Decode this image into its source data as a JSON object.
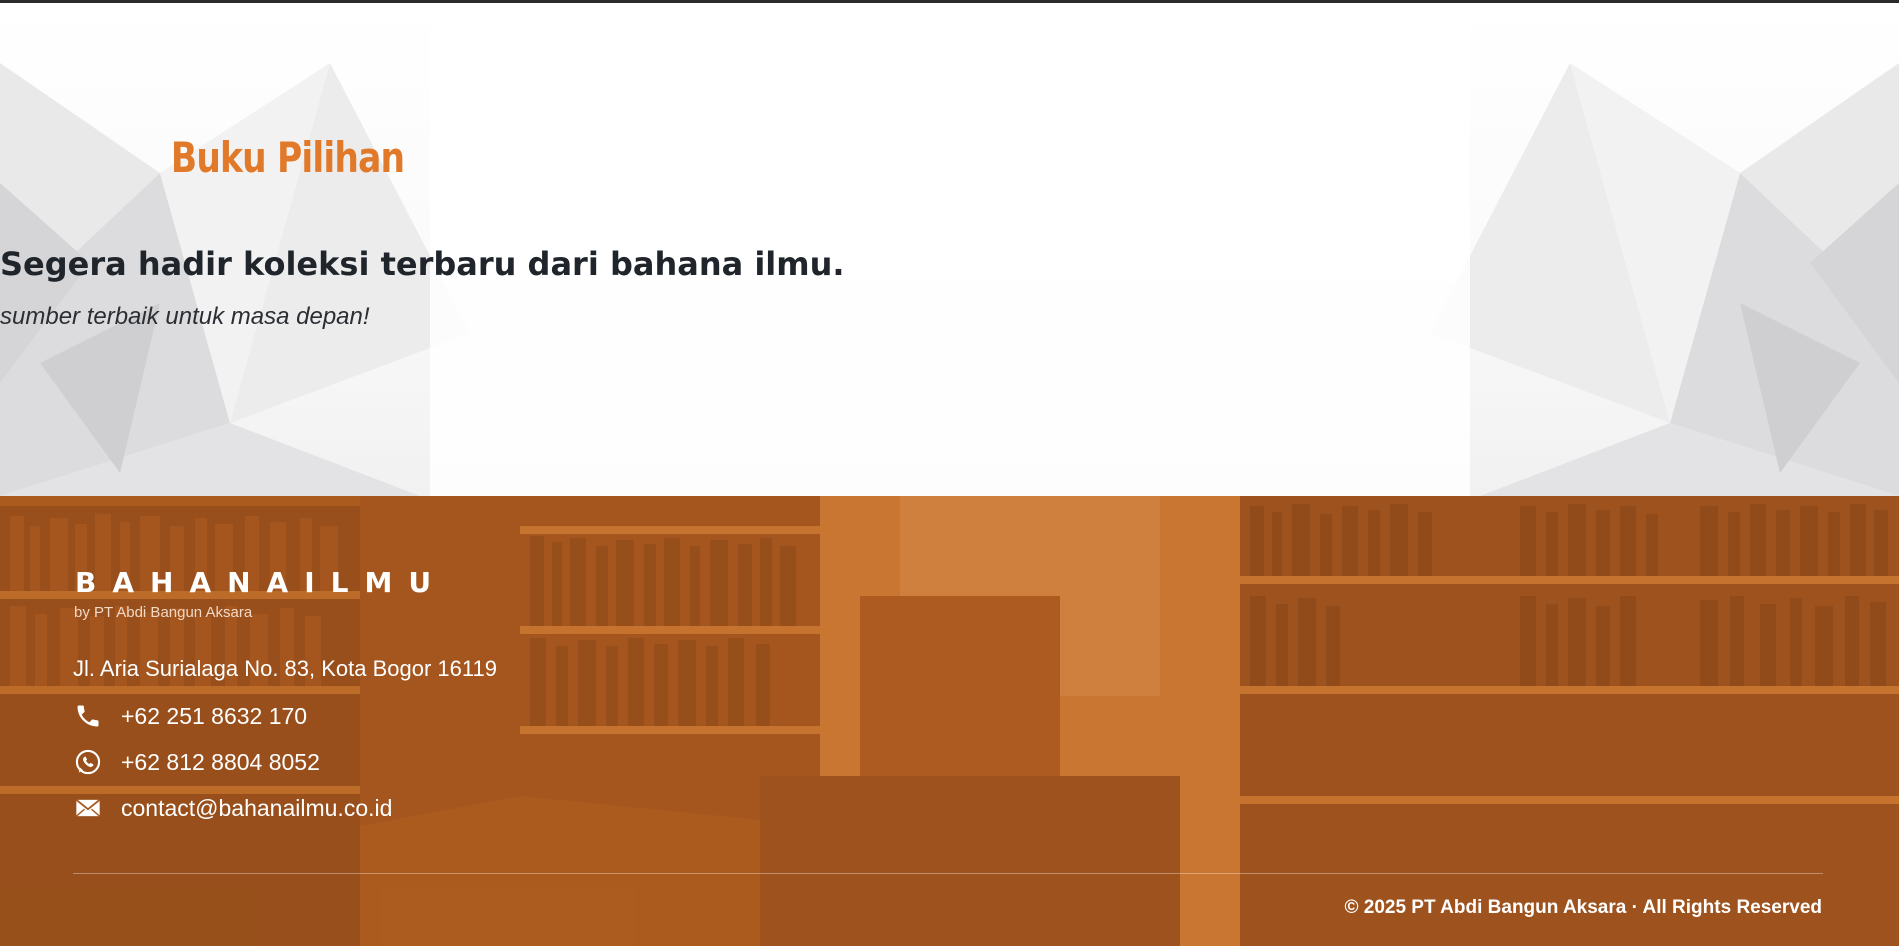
{
  "hero": {
    "title": "Buku Pilihan",
    "heading": "Segera hadir koleksi terbaru dari bahana ilmu.",
    "subheading": "sumber terbaik untuk masa depan!"
  },
  "footer": {
    "brand": "BAHANAILMU",
    "brand_by": "by PT Abdi Bangun Aksara",
    "address": "Jl. Aria Surialaga No. 83, Kota Bogor 16119",
    "contacts": [
      {
        "icon": "phone-icon",
        "text": "+62 251 8632 170"
      },
      {
        "icon": "whatsapp-icon",
        "text": "+62 812 8804 8052"
      },
      {
        "icon": "mail-icon",
        "text": "contact@bahanailmu.co.id"
      }
    ],
    "copyright": "© 2025 PT Abdi Bangun Aksara · All Rights Reserved"
  },
  "colors": {
    "accent": "#e07a2a",
    "footer_overlay": "#c86e28",
    "heading_text": "#1f252b"
  }
}
